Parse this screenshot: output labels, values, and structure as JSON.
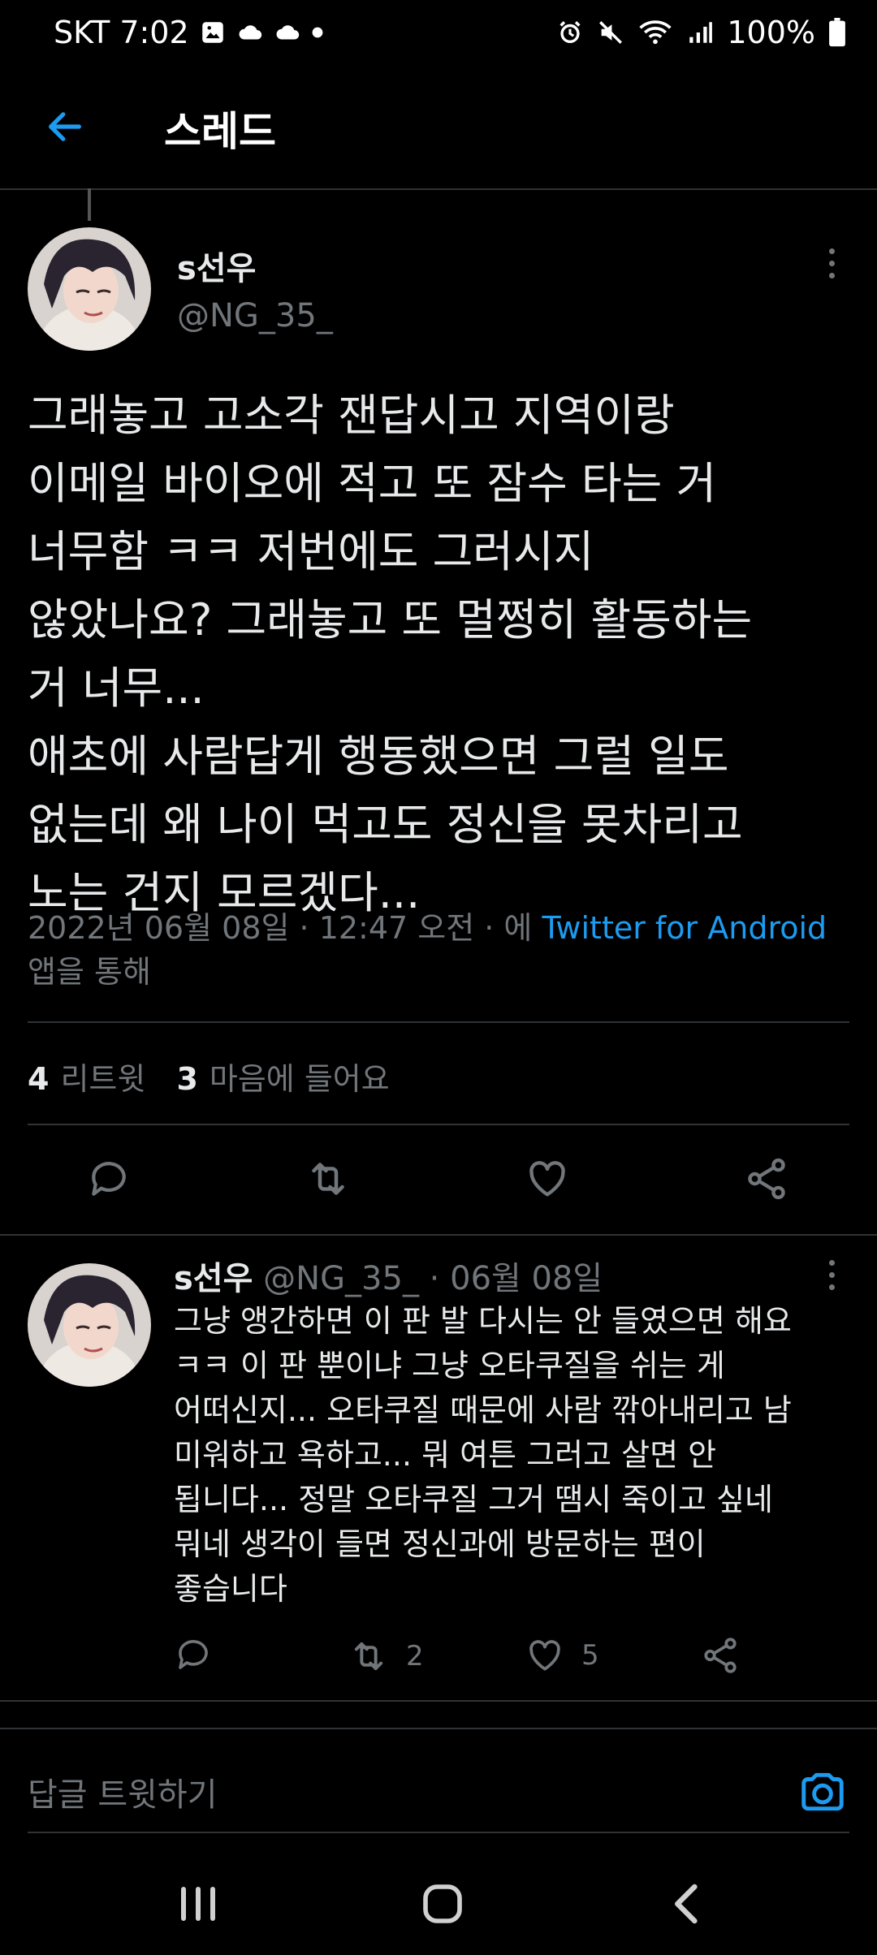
{
  "status_bar": {
    "carrier": "SKT",
    "time": "7:02",
    "battery": "100%"
  },
  "header": {
    "title": "스레드"
  },
  "main_tweet": {
    "name": "s선우",
    "handle": "@NG_35_",
    "text": "그래놓고 고소각 잰답시고 지역이랑\n이메일 바이오에 적고 또 잠수 타는 거\n너무함 ㅋㅋ 저번에도 그러시지\n않았나요? 그래놓고 또 멀쩡히 활동하는\n거 너무...\n애초에 사람답게 행동했으면 그럴 일도\n없는데 왜 나이 먹고도 정신을 못차리고\n노는 건지 모르겠다...",
    "date_prefix": "2022년 06월 08일 · 12:47 오전 · 에 ",
    "client": "Twitter for Android",
    "client_suffix": "앱을 통해",
    "retweets_count": "4",
    "retweets_label": "리트윗",
    "likes_count": "3",
    "likes_label": "마음에 들어요"
  },
  "reply_tweet": {
    "name": "s선우",
    "handle": "@NG_35_",
    "date": " · 06월 08일",
    "text": "그냥 앵간하면 이 판 발 다시는 안 들였으면 해요\nㅋㅋ 이 판 뿐이냐 그냥 오타쿠질을 쉬는 게\n어떠신지... 오타쿠질 때문에 사람 깎아내리고 남\n미워하고 욕하고... 뭐 여튼 그러고 살면 안\n됩니다... 정말 오타쿠질 그거 땜시 죽이고 싶네\n뭐네 생각이 들면 정신과에 방문하는 편이\n좋습니다",
    "retweets": "2",
    "likes": "5"
  },
  "reply_bar": {
    "placeholder": "답글 트윗하기"
  },
  "colors": {
    "accent": "#1d9bf0",
    "text": "#e7e9ea",
    "muted": "#71767b",
    "divider": "#2f3336"
  }
}
